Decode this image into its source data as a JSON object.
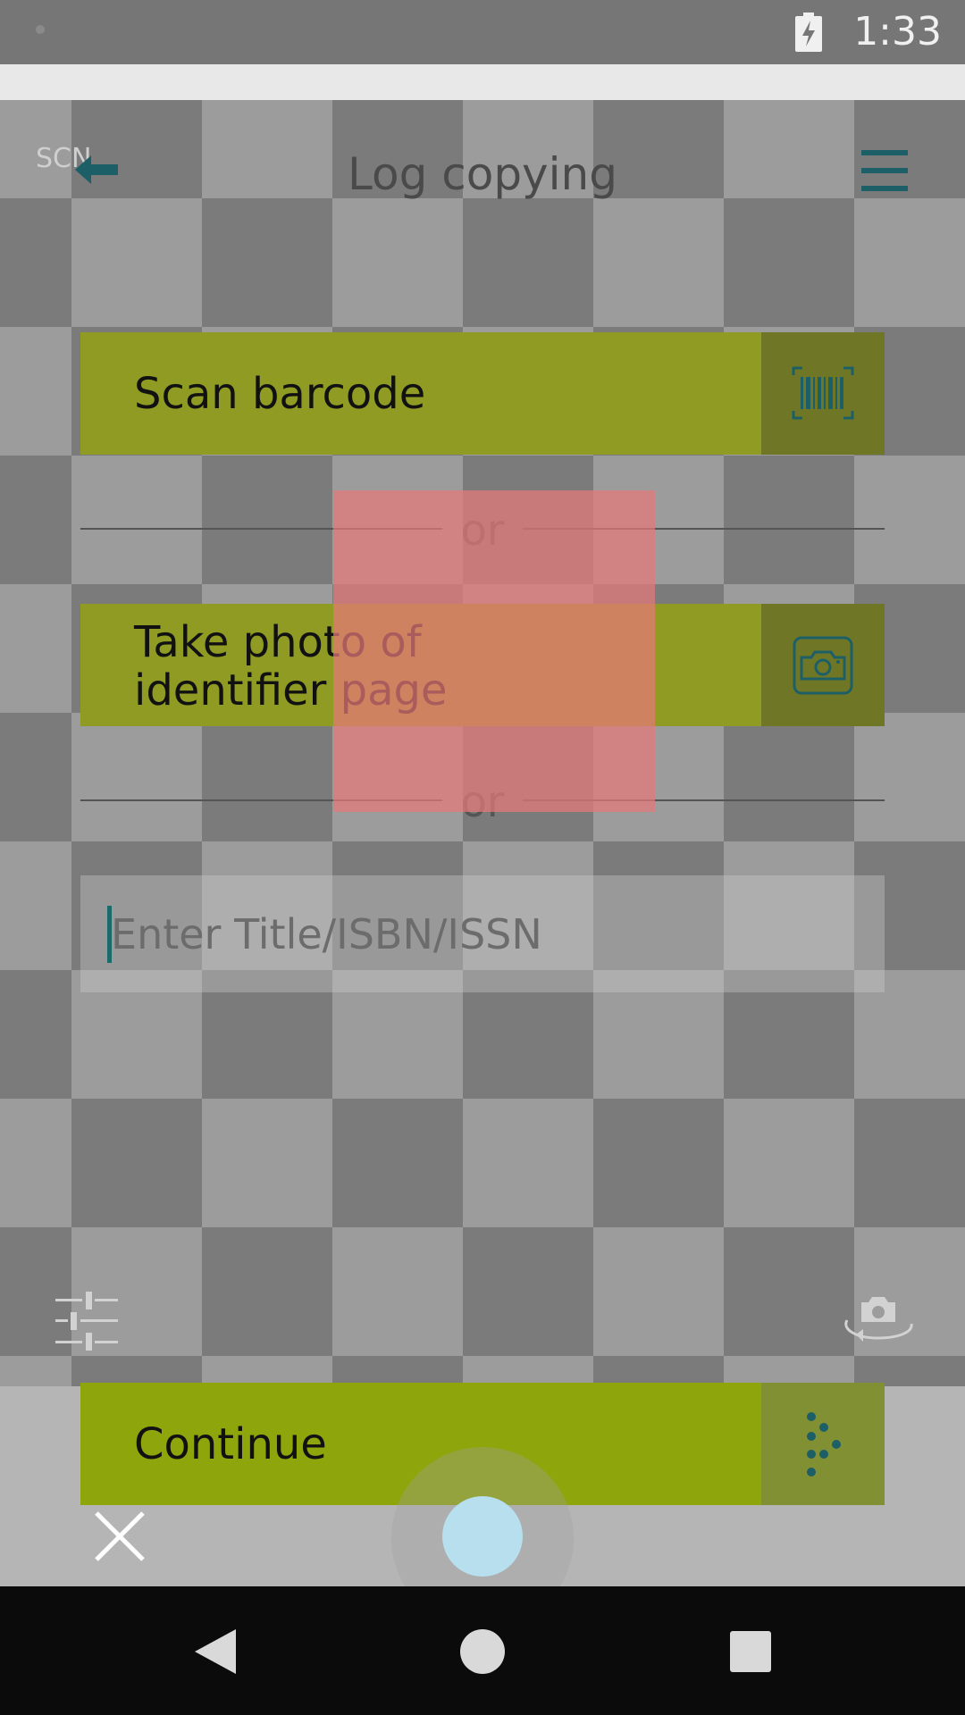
{
  "status_bar": {
    "time": "1:33"
  },
  "header": {
    "corner_label": "SCN",
    "title": "Log copying"
  },
  "actions": {
    "scan_barcode": "Scan barcode",
    "separator_1": "or",
    "take_photo_line1": "Take photo of",
    "take_photo_line2": "identifier page",
    "separator_2": "or"
  },
  "search": {
    "placeholder": "Enter Title/ISBN/ISSN",
    "value": ""
  },
  "footer": {
    "continue_label": "Continue"
  },
  "icons": {
    "back": "back-arrow-icon",
    "menu": "hamburger-menu-icon",
    "barcode": "barcode-icon",
    "camera": "camera-icon",
    "continue": "dots-arrow-icon",
    "sliders": "sliders-icon",
    "switch_camera": "switch-camera-icon",
    "close": "close-icon"
  },
  "colors": {
    "accent": "#1c6b6b",
    "button_green": "#8f9b22",
    "continue_green": "#8fa50c",
    "overlay_red": "#e67878",
    "shutter": "#b7dfee"
  }
}
